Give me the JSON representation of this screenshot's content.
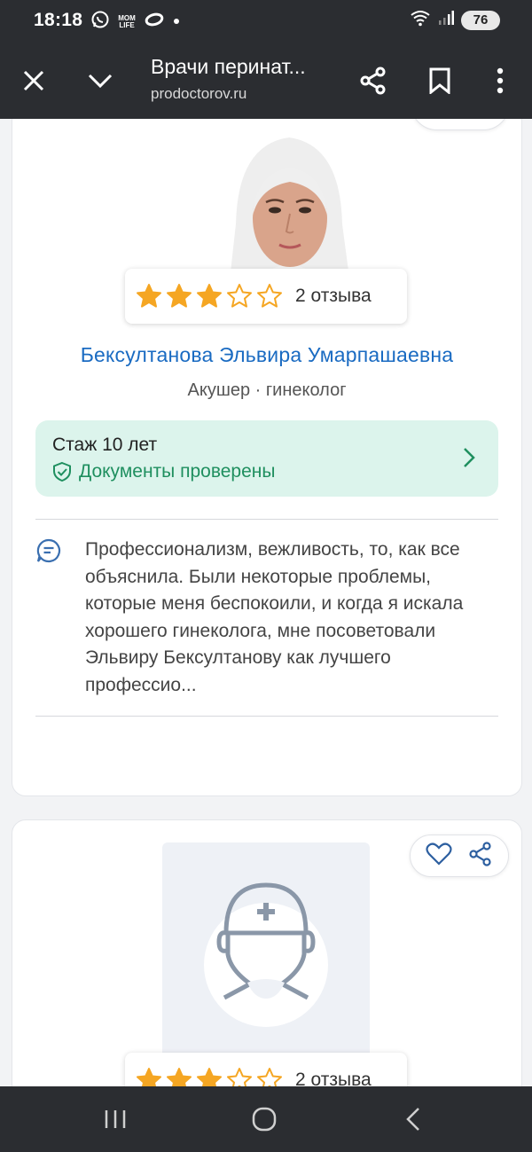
{
  "status": {
    "time": "18:18",
    "notif_label": "MOM LIFE",
    "battery": "76"
  },
  "toolbar": {
    "title": "Врачи перинат...",
    "url": "prodoctorov.ru"
  },
  "doctor1": {
    "rating": 3,
    "max_rating": 5,
    "reviews": "2 отзыва",
    "name": "Бексултанова Эльвира Умарпашаевна",
    "specialty": "Акушер · гинеколог",
    "experience": "Стаж 10 лет",
    "verified": "Документы проверены",
    "review": "Профессионализм, вежливость, то, как все объяснила. Были некоторые проблемы, которые меня беспокоили, и когда я искала хорошего гинеколога, мне посоветовали Эльвиру Бексултанову как лучшего профессио..."
  },
  "doctor2": {
    "rating": 3,
    "max_rating": 5,
    "reviews": "2 отзыва"
  },
  "colors": {
    "accent_link": "#1a6bc2",
    "star": "#f5a623",
    "verified_green": "#1f8f5f",
    "exp_bg": "#dcf4ec"
  }
}
